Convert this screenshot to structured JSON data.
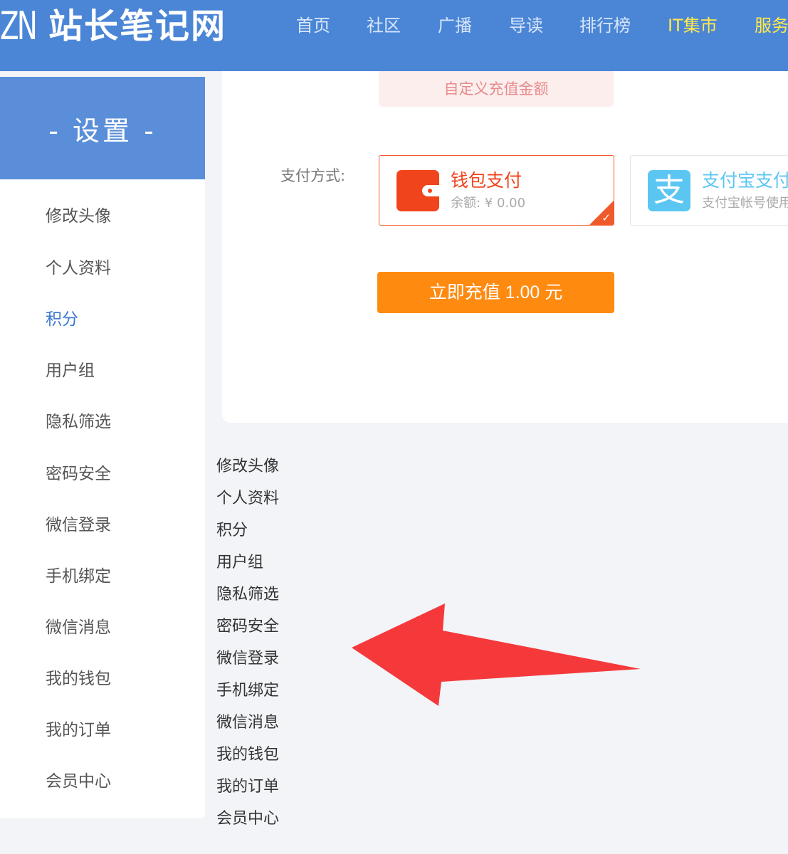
{
  "header": {
    "logo_mark": "ZN",
    "logo_text": "站长笔记网",
    "nav": [
      "首页",
      "社区",
      "广播",
      "导读",
      "排行榜",
      "IT集市",
      "服务"
    ]
  },
  "sidebar": {
    "title": "-  设置  -",
    "items": [
      "修改头像",
      "个人资料",
      "积分",
      "用户组",
      "隐私筛选",
      "密码安全",
      "微信登录",
      "手机绑定",
      "微信消息",
      "我的钱包",
      "我的订单",
      "会员中心"
    ],
    "active_index": 2
  },
  "payment": {
    "custom_amount_label": "自定义充值金额",
    "method_label": "支付方式:",
    "wallet": {
      "title": "钱包支付",
      "subtitle": "余额: ¥ 0.00",
      "selected": true
    },
    "alipay": {
      "title": "支付宝支付",
      "subtitle": "支付宝帐号使用",
      "icon_glyph": "支"
    },
    "recharge_button": "立即充值  1.00 元"
  },
  "plain_links": [
    "修改头像",
    "个人资料",
    "积分",
    "用户组",
    "隐私筛选",
    "密码安全",
    "微信登录",
    "手机绑定",
    "微信消息",
    "我的钱包",
    "我的订单",
    "会员中心"
  ],
  "colors": {
    "header_bg": "#4b86d6",
    "nav_highlight": "#ffe94d",
    "wallet_red": "#f0441c",
    "alipay_blue": "#5cc6f2",
    "button_orange": "#ff8a10",
    "arrow_red": "#f5393b"
  },
  "icons": {
    "wallet": "wallet-icon",
    "alipay": "alipay-icon",
    "check": "checkmark-icon",
    "annotation": "red-arrow-icon"
  }
}
